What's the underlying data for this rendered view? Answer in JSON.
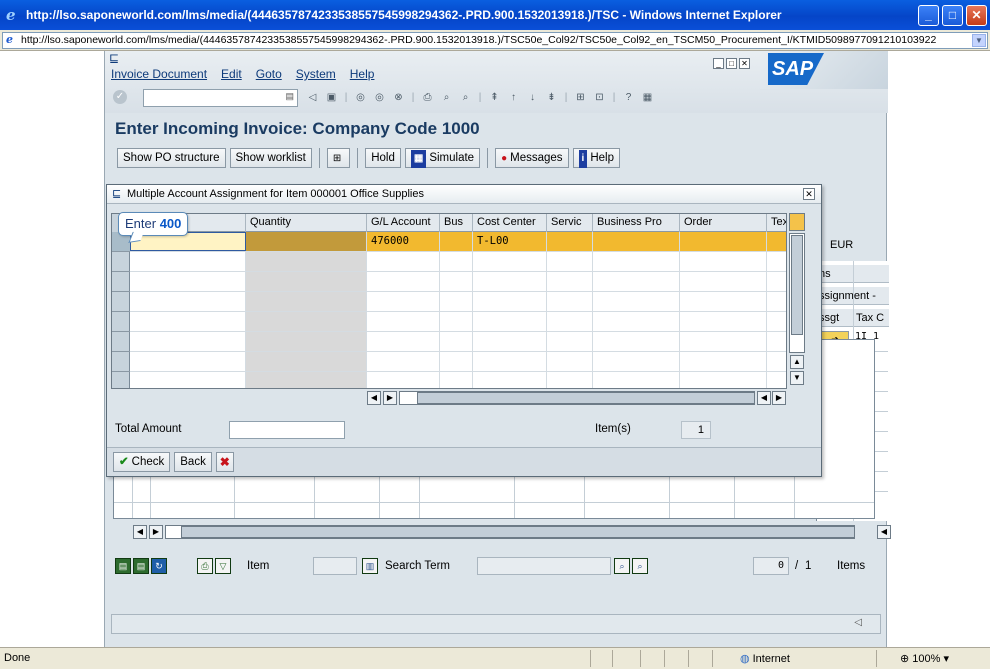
{
  "browser": {
    "title": "http://lso.saponeworld.com/lms/media/(4446357874233538557545998294362-.PRD.900.1532013918.)/TSC - Windows Internet Explorer",
    "address": "http://lso.saponeworld.com/lms/media/(4446357874233538557545998294362-.PRD.900.1532013918.)/TSC50e_Col92/TSC50e_Col92_en_TSCM50_Procurement_I/KTMID5098977091210103922",
    "status_text": "Done",
    "zone": "Internet",
    "zoom": "100%"
  },
  "sap": {
    "menu": [
      "Invoice Document",
      "Edit",
      "Goto",
      "System",
      "Help"
    ],
    "logo": "SAP",
    "page_title": "Enter Incoming Invoice: Company Code 1000",
    "app_toolbar": {
      "show_po_structure": "Show PO structure",
      "show_worklist": "Show worklist",
      "hold": "Hold",
      "simulate": "Simulate",
      "messages": "Messages",
      "help": "Help"
    },
    "currency": "EUR",
    "background_right_headers": [
      "ns",
      "ssignment -",
      "ssgt",
      "Tax C"
    ],
    "background_right_value": "1I 1",
    "bottom": {
      "item_label": "Item",
      "search_term_label": "Search Term",
      "page_current": "0",
      "page_sep": "/",
      "page_total": "1",
      "items_label": "Items"
    }
  },
  "popup": {
    "title": "Multiple Account Assignment for Item 000001 Office Supplies",
    "columns": [
      "",
      "Quantity",
      "G/L Account",
      "Bus",
      "Cost Center",
      "Servic",
      "Business Pro",
      "Order",
      "Tex"
    ],
    "rows": [
      {
        "gl_account": "476000",
        "cost_center": "T-L00"
      }
    ],
    "total_amount_label": "Total Amount",
    "total_amount_value": "",
    "items_label": "Item(s)",
    "items_value": "1",
    "check_label": "Check",
    "back_label": "Back"
  },
  "tooltip": {
    "prefix": "Enter",
    "value": "400"
  }
}
